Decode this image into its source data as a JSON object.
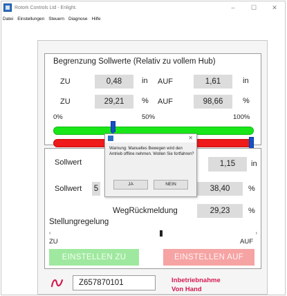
{
  "window": {
    "title": "Rotork Controls Ltd - Enlight.",
    "controls": {
      "minimize": "–",
      "maximize": "☐",
      "close": "✕"
    }
  },
  "menu": [
    "Datei",
    "Einstellungen",
    "Steuern",
    "Diagnose",
    "Hilfe"
  ],
  "limits_panel": {
    "title": "Begrenzung Sollwerte (Relativ zu vollem Hub)",
    "row1": {
      "zu_label": "ZU",
      "zu_value": "0,48",
      "zu_unit": "in",
      "auf_label": "AUF",
      "auf_value": "1,61",
      "auf_unit": "in"
    },
    "row2": {
      "zu_label": "ZU",
      "zu_value": "29,21",
      "zu_unit": "%",
      "auf_label": "AUF",
      "auf_value": "98,66",
      "auf_unit": "%"
    },
    "scale": {
      "min": "0%",
      "mid": "50%",
      "max": "100%"
    },
    "green_slider_percent": 29.21,
    "red_slider_percent": 98.66,
    "colors": {
      "green": "#19e619",
      "red": "#ef1a1a",
      "thumb": "#1450c8"
    }
  },
  "position_panel": {
    "setpoint1_label": "Sollwert",
    "setpoint1_value": "1,15",
    "setpoint1_unit": "in",
    "setpoint2_label": "Sollwert",
    "setpoint2_partial": "5",
    "setpoint2_value": "38,40",
    "setpoint2_unit": "%",
    "feedback_label": "WegRückmeldung",
    "feedback_value": "29,23",
    "feedback_unit": "%",
    "control_label": "Stellungregelung",
    "scroll_left": "‹",
    "scroll_right": "›",
    "zu_label": "ZU",
    "auf_label": "AUF",
    "button_close": "EINSTELLEN ZU",
    "button_open": "EINSTELLEN AUF"
  },
  "footer": {
    "serial": "Z657870101",
    "status_line1": "Inbetriebnahme",
    "status_line2": "Von Hand",
    "status_color": "#d41a52"
  },
  "dialog": {
    "close": "✕",
    "message": "Warnung: Manuelles Bewegen wird den Antrieb offline nehmen. Wollen Sie fortfahren?",
    "yes": "JA",
    "no": "NEIN"
  }
}
